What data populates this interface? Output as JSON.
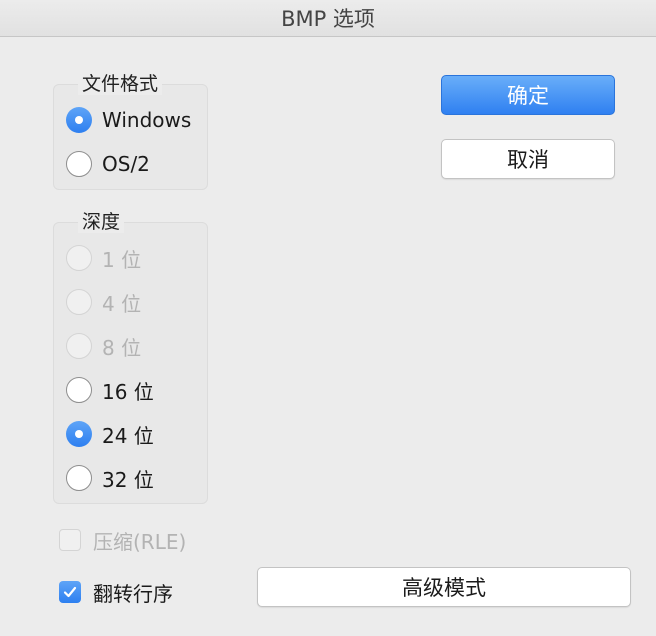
{
  "window": {
    "title": "BMP 选项"
  },
  "file_format": {
    "title": "文件格式",
    "options": [
      {
        "label": "Windows",
        "selected": true,
        "enabled": true
      },
      {
        "label": "OS/2",
        "selected": false,
        "enabled": true
      }
    ]
  },
  "depth": {
    "title": "深度",
    "options": [
      {
        "label": "1 位",
        "selected": false,
        "enabled": false
      },
      {
        "label": "4 位",
        "selected": false,
        "enabled": false
      },
      {
        "label": "8 位",
        "selected": false,
        "enabled": false
      },
      {
        "label": "16 位",
        "selected": false,
        "enabled": true
      },
      {
        "label": "24 位",
        "selected": true,
        "enabled": true
      },
      {
        "label": "32 位",
        "selected": false,
        "enabled": true
      }
    ]
  },
  "options": {
    "compress_label": "压缩(RLE)",
    "compress_checked": false,
    "compress_enabled": false,
    "flip_label": "翻转行序",
    "flip_checked": true,
    "flip_enabled": true
  },
  "buttons": {
    "ok": "确定",
    "cancel": "取消",
    "advanced": "高级模式"
  },
  "colors": {
    "accent": "#2f80f1",
    "disabled_text": "#b3b3b3"
  }
}
